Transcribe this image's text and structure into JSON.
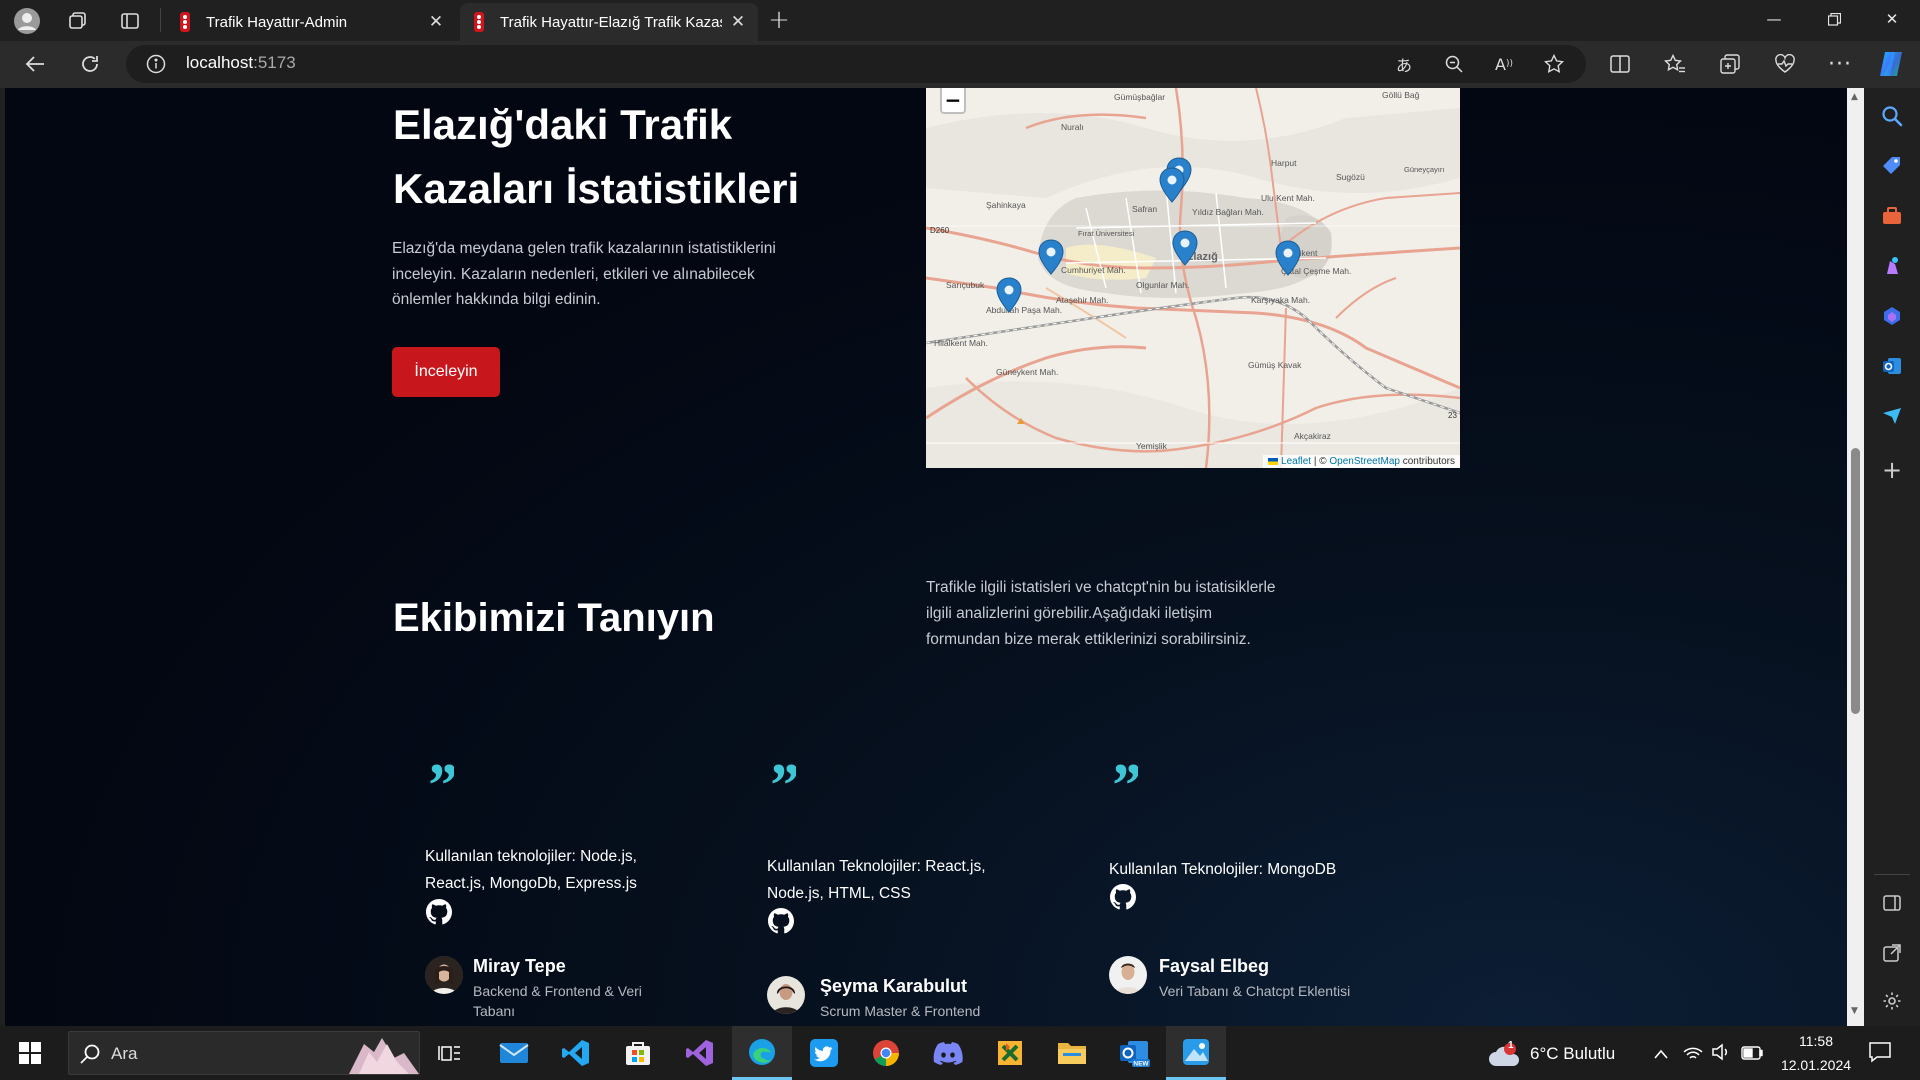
{
  "browser": {
    "tabs": [
      {
        "title": "Trafik Hayattır-Admin",
        "active": false
      },
      {
        "title": "Trafik Hayattır-Elazığ Trafik Kazası",
        "active": true
      }
    ],
    "address": {
      "host": "localhost",
      "port": ":5173"
    }
  },
  "hero": {
    "title": "Elazığ'daki Trafik Kazaları İstatistikleri",
    "description": "Elazığ'da meydana gelen trafik kazalarının istatistiklerini inceleyin. Kazaların nedenleri, etkileri ve alınabilecek önlemler hakkında bilgi edinin.",
    "button": "İnceleyin"
  },
  "map": {
    "zoom_out": "−",
    "places": [
      "Gümüşbağlar",
      "Göllü Bağ",
      "Nuralı",
      "Harput",
      "Sugözü",
      "Güneyçayırı",
      "Şahinkaya",
      "Safran",
      "Yıldız Bağları Mah.",
      "Ulu Kent Mah.",
      "Fırat Üniversitesi",
      "Cumhuriyet Mah.",
      "Elazığ",
      "Doğukent",
      "Çatal Çeşme Mah.",
      "Sarıçubuk",
      "Olgunlar Mah.",
      "Abdullah Paşa Mah.",
      "Ataşehir Mah.",
      "Karşıyaka Mah.",
      "Hilalkent Mah.",
      "Güneykent Mah.",
      "Gümüş Kavak",
      "Akçakiraz",
      "Yemişlik",
      "D260",
      "23"
    ],
    "attribution": {
      "leaflet": "Leaflet",
      "sep": " | © ",
      "osm": "OpenStreetMap",
      "rest": " contributors"
    }
  },
  "team": {
    "title": "Ekibimizi Tanıyın",
    "intro": "Trafikle ilgili istatisleri ve chatcpt'nin bu istatisiklerle ilgili analizlerini görebilir.Aşağıdaki iletişim formundan bize merak ettiklerinizi sorabilirsiniz.",
    "quote": "”",
    "members": [
      {
        "tech": "Kullanılan teknolojiler: Node.js, React.js, MongoDb, Express.js",
        "name": "Miray Tepe",
        "role": "Backend & Frontend & Veri Tabanı"
      },
      {
        "tech": "Kullanılan Teknolojiler: React.js, Node.js, HTML, CSS",
        "name": "Şeyma Karabulut",
        "role": "Scrum Master & Frontend"
      },
      {
        "tech": "Kullanılan Teknolojiler: MongoDB",
        "name": "Faysal Elbeg",
        "role": "Veri Tabanı & Chatcpt Eklentisi"
      }
    ]
  },
  "taskbar": {
    "search": "Ara",
    "weather": "6°C  Bulutlu",
    "weather_badge": "1",
    "time": "11:58",
    "date": "12.01.2024"
  },
  "colors": {
    "accent_red": "#c8171c",
    "quote_cyan": "#3fc6d6",
    "page_bg": "#030712"
  }
}
